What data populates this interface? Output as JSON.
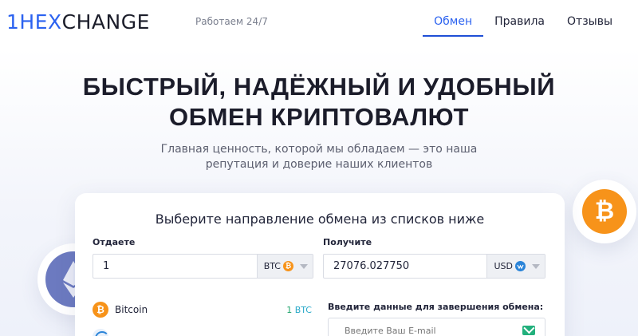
{
  "header": {
    "logo_part1": "1HE",
    "logo_x": "X",
    "logo_part2": "CHANGE",
    "tagline": "Работаем 24/7",
    "nav": [
      {
        "label": "Обмен",
        "active": true
      },
      {
        "label": "Правила",
        "active": false
      },
      {
        "label": "Отзывы",
        "active": false
      }
    ]
  },
  "hero": {
    "title_line1": "БЫСТРЫЙ, НАДЁЖНЫЙ И УДОБНЫЙ",
    "title_line2": "ОБМЕН КРИПТОВАЛЮТ",
    "subtitle_line1": "Главная ценность, которой мы обладаем — это наша",
    "subtitle_line2": "репутация и доверие наших клиентов"
  },
  "exchange": {
    "title": "Выберите направление обмена из списков ниже",
    "give": {
      "label": "Отдаете",
      "amount": "1",
      "currency": "BTC",
      "currency_icon": "bitcoin-icon"
    },
    "get": {
      "label": "Получите",
      "amount": "27076.027750",
      "currency": "USD",
      "currency_icon": "webmoney-icon"
    },
    "list": [
      {
        "name": "Bitcoin",
        "amount": "1",
        "unit": "BTC",
        "icon": "bitcoin-icon"
      }
    ],
    "details_title": "Введите данные для завершения обмена:",
    "email_placeholder": "Введите Ваш E-mail"
  },
  "colors": {
    "accent": "#2b62f0",
    "btc": "#f7931a",
    "eth": "#6c7ac0",
    "success": "#22b07c"
  }
}
